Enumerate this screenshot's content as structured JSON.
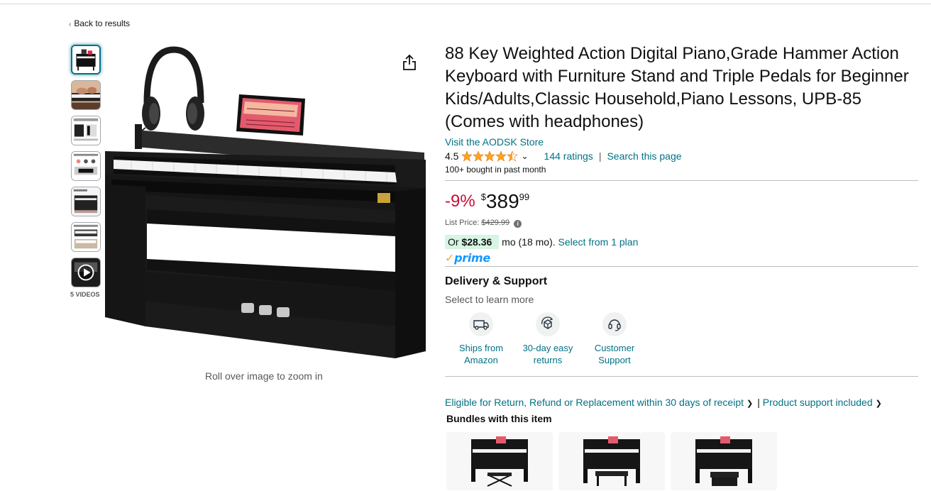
{
  "nav": {
    "back_label": "Back to results"
  },
  "gallery": {
    "thumbnails": [
      {
        "name": "thumb-main"
      },
      {
        "name": "thumb-hands"
      },
      {
        "name": "thumb-feature-1"
      },
      {
        "name": "thumb-feature-2"
      },
      {
        "name": "thumb-feature-3"
      },
      {
        "name": "thumb-feature-4"
      },
      {
        "name": "thumb-video"
      }
    ],
    "videos_label": "5 VIDEOS",
    "zoom_hint": "Roll over image to zoom in"
  },
  "product": {
    "title": "88 Key Weighted Action Digital Piano,Grade Hammer Action Keyboard with Furniture Stand and Triple Pedals for Beginner Kids/Adults,Classic Household,Piano Lessons, UPB-85 (Comes with headphones)",
    "store_link": "Visit the AODSK Store",
    "rating_value": "4.5",
    "rating_stars": 4.5,
    "ratings_count": "144 ratings",
    "search_page": "Search this page",
    "bought_text": "100+ bought in past month"
  },
  "price": {
    "discount": "-9%",
    "currency": "$",
    "whole": "389",
    "fraction": "99",
    "list_price_label": "List Price:",
    "list_price": "$429.99",
    "plan_prefix": "Or",
    "plan_amount": "$28.36",
    "plan_suffix": "mo (18 mo).",
    "plan_link": "Select from 1 plan",
    "prime_label": "prime"
  },
  "delivery": {
    "title": "Delivery & Support",
    "subtitle": "Select to learn more",
    "features": [
      {
        "label_line1": "Ships from",
        "label_line2": "Amazon",
        "icon": "van-icon"
      },
      {
        "label_line1": "30-day easy",
        "label_line2": "returns",
        "icon": "return-box-icon"
      },
      {
        "label_line1": "Customer",
        "label_line2": "Support",
        "icon": "headset-icon"
      }
    ]
  },
  "returns": {
    "eligible_text": "Eligible for Return, Refund or Replacement within 30 days of receipt",
    "support_text": "Product support included",
    "separator": "|"
  },
  "bundles": {
    "title": "Bundles with this item",
    "items": [
      {
        "name": "bundle-x-stand"
      },
      {
        "name": "bundle-bench"
      },
      {
        "name": "bundle-bench-2"
      }
    ]
  },
  "colors": {
    "link": "#007185",
    "discount": "#cc0c39",
    "star": "#ffa41c",
    "prime": "#1399ff",
    "plan_badge": "#d6f5e3"
  }
}
